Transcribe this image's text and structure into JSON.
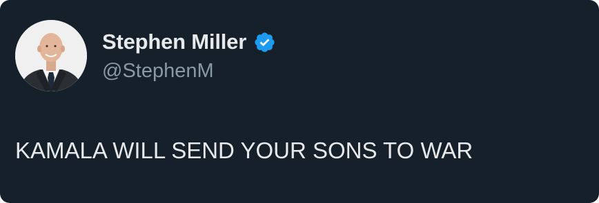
{
  "tweet": {
    "author": {
      "display_name": "Stephen Miller",
      "handle": "@StephenM",
      "verified": true,
      "verified_icon": "verified-badge-icon",
      "avatar_icon": "profile-photo"
    },
    "text": "KAMALA WILL SEND YOUR SONS TO WAR"
  },
  "colors": {
    "background": "#15202b",
    "primary_text": "#e7e9ea",
    "secondary_text": "#8b98a5",
    "verified_blue": "#1d9bf0"
  }
}
